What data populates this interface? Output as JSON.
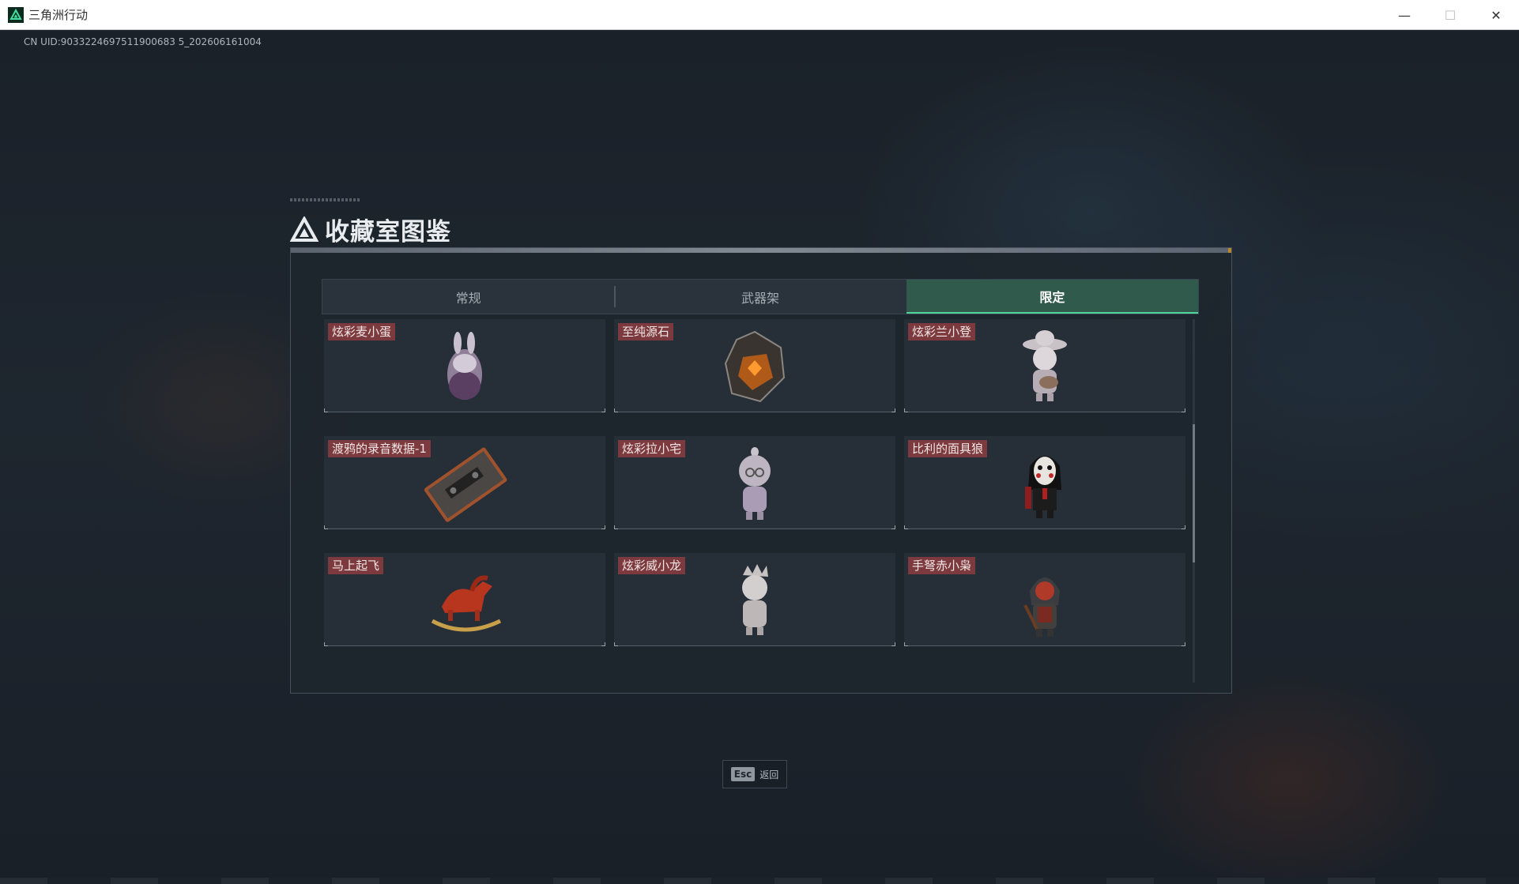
{
  "window": {
    "title": "三角洲行动",
    "controls": {
      "minimize": "—",
      "maximize": "☐",
      "close": "✕"
    }
  },
  "uid_text": "CN UID:9033224697511900683 5_202606161004",
  "dialog": {
    "title": "收藏室图鉴",
    "tabs": [
      {
        "label": "常规",
        "active": false
      },
      {
        "label": "武器架",
        "active": false
      },
      {
        "label": "限定",
        "active": true
      }
    ],
    "items": [
      {
        "label": "炫彩麦小蛋",
        "icon": "rabbit-egg-figure-icon"
      },
      {
        "label": "至纯源石",
        "icon": "crystal-stone-icon"
      },
      {
        "label": "炫彩兰小登",
        "icon": "sombrero-figure-icon"
      },
      {
        "label": "渡鸦的录音数据-1",
        "icon": "cassette-tape-icon"
      },
      {
        "label": "炫彩拉小宅",
        "icon": "hooded-figure-icon"
      },
      {
        "label": "比利的面具狼",
        "icon": "masked-puppet-icon"
      },
      {
        "label": "马上起飞",
        "icon": "rocking-horse-icon"
      },
      {
        "label": "炫彩威小龙",
        "icon": "crowned-figure-icon"
      },
      {
        "label": "手弩赤小枭",
        "icon": "hooded-archer-icon"
      }
    ]
  },
  "esc_hint": {
    "key": "Esc",
    "label": "返回"
  },
  "colors": {
    "accent": "#4fd59c",
    "active_tab": "#2f5a4c",
    "item_label_bg": "#7d3a3e"
  }
}
